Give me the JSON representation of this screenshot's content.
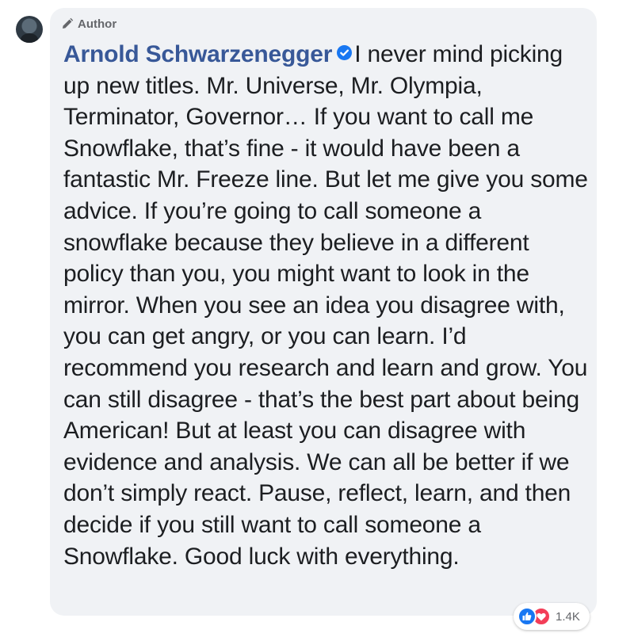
{
  "comment": {
    "badge_label": "Author",
    "badge_icon": "pencil-icon",
    "author_name": "Arnold Schwarzenegger",
    "verified_icon": "verified-badge-icon",
    "text": "I never mind picking up new titles. Mr. Universe, Mr. Olympia, Terminator, Governor… If you want to call me Snowflake, that’s fine - it would have been a fantastic Mr. Freeze line. But let me give you some advice. If you’re going to call someone a snowflake because they believe in a different policy than you, you might want to look in the mirror. When you see an idea you disagree with, you can get angry, or you can learn. I’d recommend you research and learn and grow. You can still disagree - that’s the best part about being American! But at least you can disagree with evidence and analysis. We can all be better if we don’t simply react. Pause, reflect, learn, and then decide if you still want to call someone a Snowflake. Good luck with everything."
  },
  "reactions": {
    "icons": [
      "like-icon",
      "love-icon"
    ],
    "count": "1.4K"
  },
  "colors": {
    "bubble_background": "#f0f2f5",
    "author_name": "#385898",
    "body_text": "#1c1e21",
    "secondary_text": "#65676b",
    "verified_blue": "#1877f2",
    "like_blue": "#1877f2",
    "love_red": "#f33e58"
  }
}
